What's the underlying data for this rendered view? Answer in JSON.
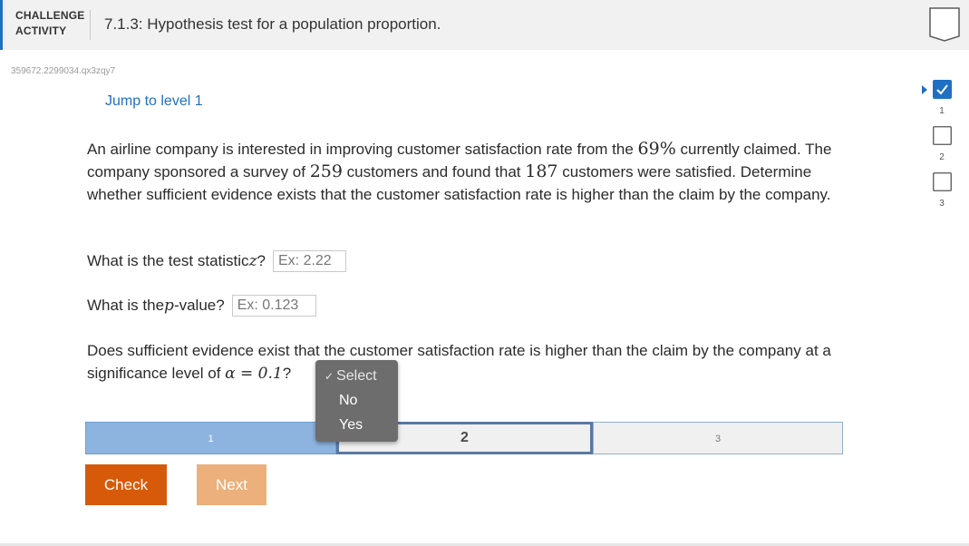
{
  "header": {
    "activity_type_line1": "CHALLENGE",
    "activity_type_line2": "ACTIVITY",
    "title": "7.1.3: Hypothesis test for a population proportion."
  },
  "activity_id": "359672.2299034.qx3zqy7",
  "jump_link": "Jump to level 1",
  "problem": {
    "line1_a": "An airline company is interested in improving customer satisfaction rate from the ",
    "claimed_rate": "69%",
    "line1_b": " currently claimed. The company sponsored a survey of ",
    "sample_size": "259",
    "line1_c": " customers and found that ",
    "satisfied": "187",
    "line1_d": " customers were satisfied. Determine whether sufficient evidence exists that the customer satisfaction rate is higher than the claim by the company."
  },
  "questions": {
    "q1_text": "What is the test statistic ",
    "q1_var": "z",
    "q1_suffix": "?",
    "q1_placeholder": "Ex: 2.22",
    "q2_text": "What is the ",
    "q2_var": "p",
    "q2_suffix": "-value?",
    "q2_placeholder": "Ex: 0.123",
    "q3_text": "Does sufficient evidence exist that the customer satisfaction rate is higher than the claim by the company at a significance level of ",
    "q3_alpha": "α = 0.1",
    "q3_suffix": "?"
  },
  "dropdown": {
    "options": [
      "Select",
      "No",
      "Yes"
    ],
    "selected": "Select"
  },
  "progress": {
    "segments": [
      "1",
      "2",
      "3"
    ],
    "current": "2"
  },
  "buttons": {
    "check": "Check",
    "next": "Next"
  },
  "levels": {
    "items": [
      {
        "label": "1",
        "status": "complete"
      },
      {
        "label": "2",
        "status": "incomplete"
      },
      {
        "label": "3",
        "status": "incomplete"
      }
    ]
  },
  "colors": {
    "accent": "#1f6fc4",
    "check_button": "#d65a09",
    "next_button": "#ebb07b",
    "progress_done": "#8db4df"
  }
}
